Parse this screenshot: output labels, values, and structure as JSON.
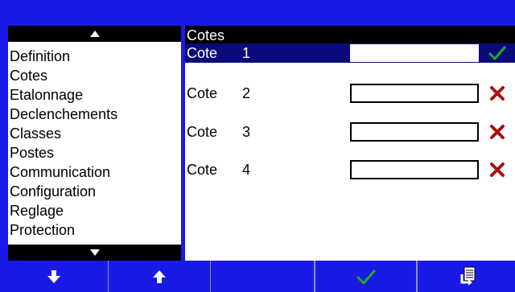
{
  "colors": {
    "background": "#1a1ae6",
    "header": "#000000",
    "selected_row": "#0a0a7c",
    "check_green": "#22aa22",
    "cross_red": "#aa1111"
  },
  "sidebar": {
    "scroll_up_icon": "triangle-up",
    "scroll_down_icon": "triangle-down",
    "items": [
      {
        "label": "Definition"
      },
      {
        "label": "Cotes"
      },
      {
        "label": "Etalonnage"
      },
      {
        "label": "Declenchements"
      },
      {
        "label": "Classes"
      },
      {
        "label": "Postes"
      },
      {
        "label": "Communication"
      },
      {
        "label": "Configuration"
      },
      {
        "label": "Reglage"
      },
      {
        "label": "Protection"
      }
    ]
  },
  "panel": {
    "title": "Cotes",
    "rows": [
      {
        "label": "Cote",
        "number": "1",
        "value": "",
        "status": "valid",
        "selected": true
      },
      {
        "label": "Cote",
        "number": "2",
        "value": "",
        "status": "invalid",
        "selected": false
      },
      {
        "label": "Cote",
        "number": "3",
        "value": "",
        "status": "invalid",
        "selected": false
      },
      {
        "label": "Cote",
        "number": "4",
        "value": "",
        "status": "invalid",
        "selected": false
      }
    ]
  },
  "toolbar": {
    "buttons": [
      {
        "icon": "arrow-down"
      },
      {
        "icon": "arrow-up"
      },
      {
        "icon": ""
      },
      {
        "icon": ""
      },
      {
        "icon": "checkmark"
      },
      {
        "icon": "enter-document"
      }
    ]
  }
}
